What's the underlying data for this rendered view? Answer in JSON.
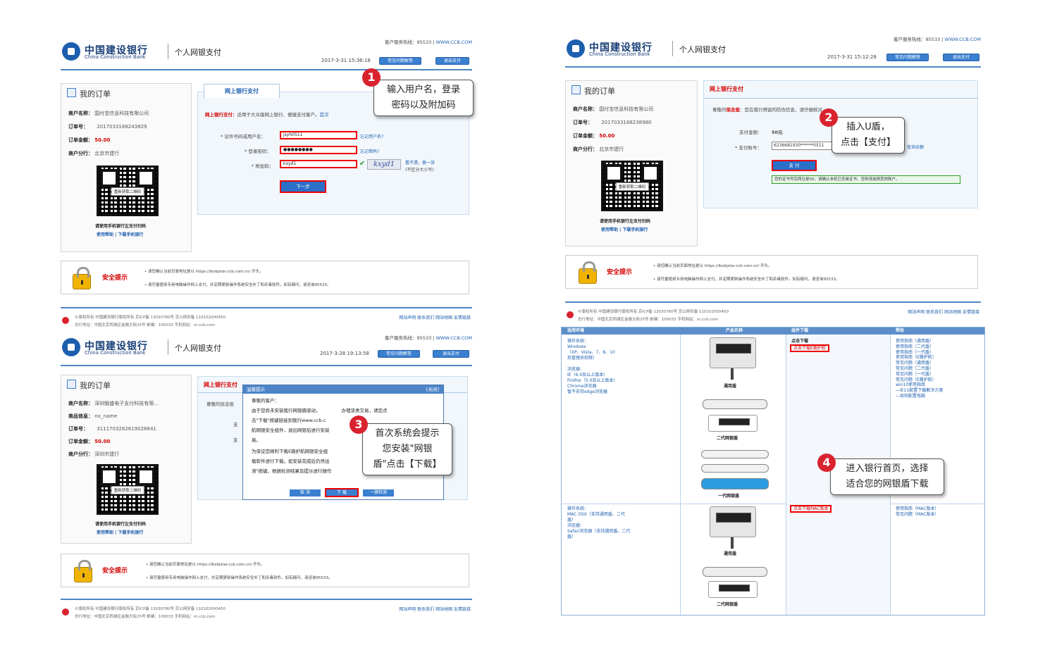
{
  "common": {
    "bank_name": "中国建设银行",
    "bank_name_en": "China Construction Bank",
    "page_title": "个人网银支付",
    "hotline": "客户服务热线：95533 | ",
    "website": "WWW.CCB.COM",
    "faq_btn": "常见问题解答",
    "exit_btn": "退出支付",
    "my_order": "我的订单",
    "qr_refresh": "重新获取二维码",
    "qr_caption": "请使用手机银行左支付扫码",
    "help_links": "使用帮助 | 下载手机银行",
    "security_title": "安全提示",
    "security_line1": "• 请您确认当前页面地址是以 https://ibsbjstar.ccb.com.cn/ 开头。",
    "security_line2": "• 请尽量使用专用电脑操作网上支付，并定期更新操作系统安全补丁和杀毒软件。如有疑问，请咨询95533。",
    "footer_line1": "©版权所有 中国建设银行版权所有 京ICP备 13030780号 京公网安备 110102000450",
    "footer_line2": "总行地址：中国北京西城区金融大街25号   邮编：100033   手机网站：m.ccb.com",
    "footer_links": "网站声明  联系我们  网站地图  友情链接",
    "merchant_label": "商户名称：",
    "order_no_label": "订单号：",
    "amount_label": "订单金额：",
    "branch_label": "商户分行：",
    "amount": "50.00"
  },
  "screen1": {
    "timestamp": "2017-3-31 15:36:18",
    "merchant": "国付宝信息科技有限公司",
    "order_no": "2017033188243829",
    "branch": "北京市建行",
    "tab": "网上银行支付",
    "intro_red": "网上银行支付：",
    "intro": "适用于大众版网上银行、便捷支付客户。",
    "intro_more": "首次",
    "user_label": "* 证件号码或用户名：",
    "user_value": "jsyh0511",
    "user_link": "忘记用户名?",
    "pwd_label": "* 登录密码：",
    "pwd_value": "●●●●●●●●",
    "pwd_link": "忘记密码?",
    "code_label": "* 附加码：",
    "code_value": "kxyd1",
    "captcha": "kxyd1",
    "captcha_link": "看不清，换一张",
    "captcha_note": "(不区分大小写)",
    "next_btn": "下一步",
    "callout_num": "1",
    "callout": "输入用户名，登录\n密码以及附加码"
  },
  "screen2": {
    "timestamp": "2017-3-31 15:12:28",
    "merchant": "国付宝信息科技有限公司",
    "order_no": "2017033188238980",
    "branch": "北京市建行",
    "tab": "网上银行支付",
    "greeting_pre": "尊敬的",
    "greeting_name": "徐志俊",
    "greeting_post": "：您在我行预留的防伪信息",
    "greeting_tail": "，请仔细核对。",
    "pay_amount_label": "支付金额：",
    "pay_amount": "50元",
    "account_label": "* 支付账号：",
    "account_value": "6236681930******0511",
    "balance_link": "查询余额",
    "pay_btn": "支 付",
    "notice": "您的证书号后两位是00，请确认本机已安装证书，否则请选择其他账户。",
    "callout_num": "2",
    "callout": "插入U盾，\n点击【支付】"
  },
  "screen3": {
    "timestamp": "2017-3-28 19:13:58",
    "merchant": "深圳银盛电子支付科技有限...",
    "product_label": "商品信息：",
    "product": "no_name",
    "order_no": "3111703282619028641",
    "branch": "深圳市建行",
    "tab": "网上银行支付",
    "greeting": "尊敬的徐志俊",
    "dialog_title": "温馨提示",
    "dialog_close": "[关闭]",
    "dlg_l1": "尊敬的客户：",
    "dlg_l2": "  由于您尚未安装我行网银盾驱动，",
    "dlg_l2b": "办理该类交易，请您点",
    "dlg_l3": "击\"下载\"按键链接到我行www.ccb.c",
    "dlg_l4": "航网银安全组件，退出网银后进行安装",
    "dlg_l5": "易。",
    "dlg_l6": "  为保证您顺利下载E路护航网银安全组",
    "dlg_l7": "载软件进行下载。如安装完成后仍然出",
    "dlg_l8": "测\"按键，根据检测结果及提示进行操作",
    "cancel_btn": "取 消",
    "download_btn": "下 载",
    "check_btn": "一键检测",
    "pay_prefix": "支",
    "callout_num": "3",
    "callout": "首次系统会提示\n您安装\"网银\n盾\"点击【下载】"
  },
  "screen4": {
    "headers": [
      "适用环境",
      "产品名称",
      "组件下载",
      "帮助"
    ],
    "env1": "操作系统：\nWindows\n（XP、Vista、7、8、10\n及管理员权限）\n\n浏览器：\nIE（6.0及以上版本）\nFirefox（5.0及以上版本）\nChrome浏览器\n暂不支持edge浏览器",
    "dl_head": "点击下载",
    "dl_link1": "点击下载E路护航",
    "help1": "使用指南（通用盾）\n使用指南（二代盾）\n使用指南（一代盾）\n使用指南（E路护航）\n常见问题（通用盾）\n常见问题（二代盾）\n常见问题（一代盾）\n常见问题（E路护航）\nwin10使用指南\n—IE11配置下载解决方案\n—如何配置电脑",
    "dev_general": "通用盾",
    "dev_gen2": "二代网银盾",
    "dev_gen1": "一代网银盾",
    "env2": "操作系统：\nMAC OSX（支持通用盾、二代\n盾）\n浏览器：\nSafari浏览器（支持通用盾、二代\n盾）",
    "dl_link2": "点击下载MAC版本",
    "help2": "使用指南（MAC版本）\n常见问题（MAC版本）",
    "callout_num": "4",
    "callout": "进入银行首页，选择\n适合您的网银盾下载"
  },
  "colors": {
    "brand": "#1d5fae",
    "accent_red": "#d40000",
    "highlight": "#ee0000",
    "callout_badge": "#d9232e"
  }
}
